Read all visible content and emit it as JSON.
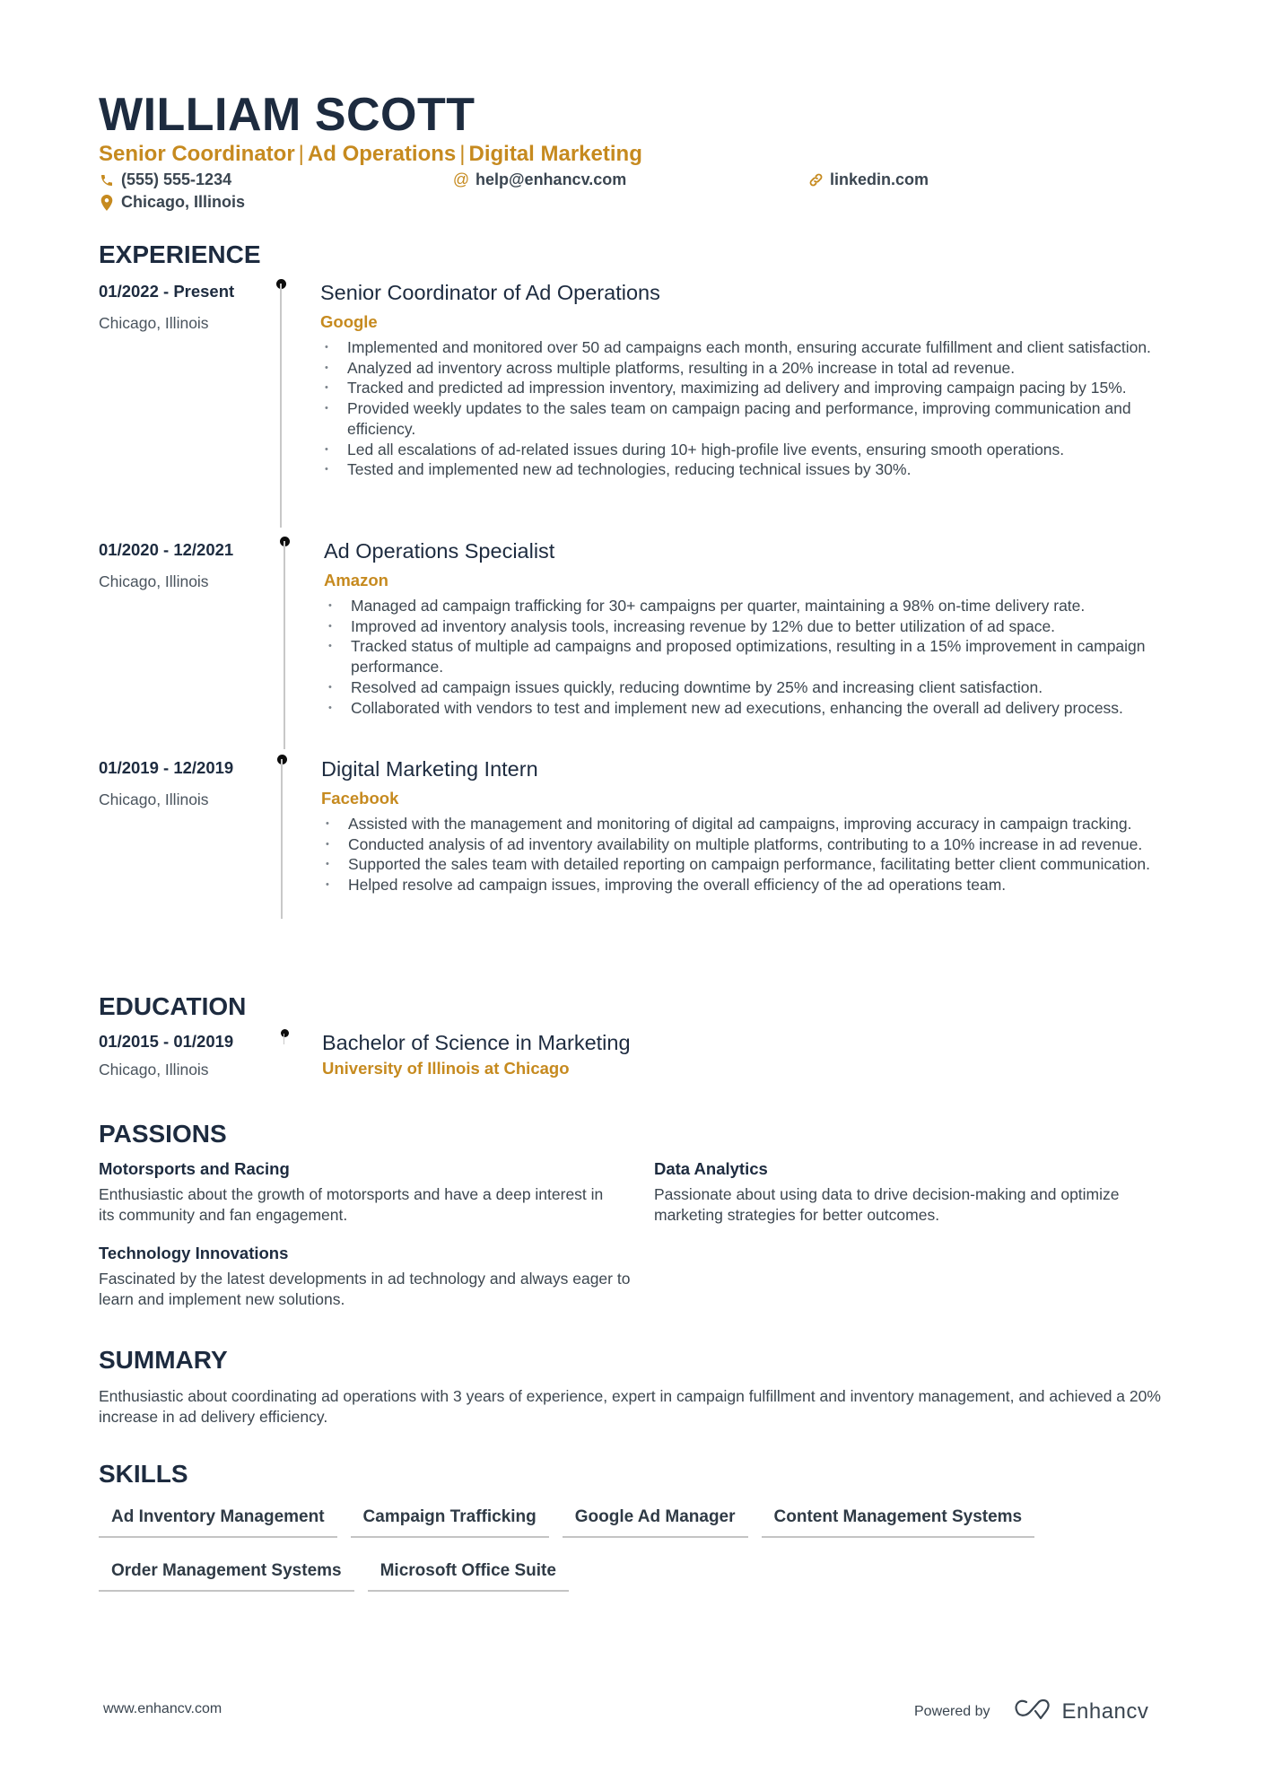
{
  "header": {
    "name": "WILLIAM SCOTT",
    "headline_parts": [
      "Senior Coordinator",
      "Ad Operations",
      "Digital Marketing"
    ],
    "headline_separator": "|",
    "contacts": {
      "phone": {
        "icon": "phone-icon",
        "value": "(555) 555-1234"
      },
      "email": {
        "icon": "at-icon",
        "value": "help@enhancv.com"
      },
      "linkedin": {
        "icon": "link-icon",
        "value": "linkedin.com"
      },
      "location": {
        "icon": "map-pin-icon",
        "value": "Chicago, Illinois"
      }
    }
  },
  "colors": {
    "accent": "#c68a1f",
    "heading": "#1d2b3f",
    "text": "#3d4750"
  },
  "experience": {
    "title": "EXPERIENCE",
    "items": [
      {
        "dates": "01/2022 - Present",
        "location": "Chicago, Illinois",
        "role": "Senior Coordinator of Ad Operations",
        "company": "Google",
        "bullets": [
          "Implemented and monitored over 50 ad campaigns each month, ensuring accurate fulfillment and client satisfaction.",
          "Analyzed ad inventory across multiple platforms, resulting in a 20% increase in total ad revenue.",
          "Tracked and predicted ad impression inventory, maximizing ad delivery and improving campaign pacing by 15%.",
          "Provided weekly updates to the sales team on campaign pacing and performance, improving communication and efficiency.",
          "Led all escalations of ad-related issues during 10+ high-profile live events, ensuring smooth operations.",
          "Tested and implemented new ad technologies, reducing technical issues by 30%."
        ]
      },
      {
        "dates": "01/2020 - 12/2021",
        "location": "Chicago, Illinois",
        "role": "Ad Operations Specialist",
        "company": "Amazon",
        "bullets": [
          "Managed ad campaign trafficking for 30+ campaigns per quarter, maintaining a 98% on-time delivery rate.",
          "Improved ad inventory analysis tools, increasing revenue by 12% due to better utilization of ad space.",
          "Tracked status of multiple ad campaigns and proposed optimizations, resulting in a 15% improvement in campaign performance.",
          "Resolved ad campaign issues quickly, reducing downtime by 25% and increasing client satisfaction.",
          "Collaborated with vendors to test and implement new ad executions, enhancing the overall ad delivery process."
        ]
      },
      {
        "dates": "01/2019 - 12/2019",
        "location": "Chicago, Illinois",
        "role": "Digital Marketing Intern",
        "company": "Facebook",
        "bullets": [
          "Assisted with the management and monitoring of digital ad campaigns, improving accuracy in campaign tracking.",
          "Conducted analysis of ad inventory availability on multiple platforms, contributing to a 10% increase in ad revenue.",
          "Supported the sales team with detailed reporting on campaign performance, facilitating better client communication.",
          "Helped resolve ad campaign issues, improving the overall efficiency of the ad operations team."
        ]
      }
    ]
  },
  "education": {
    "title": "EDUCATION",
    "items": [
      {
        "dates": "01/2015 - 01/2019",
        "location": "Chicago, Illinois",
        "degree": "Bachelor of Science in Marketing",
        "school": "University of Illinois at Chicago"
      }
    ]
  },
  "passions": {
    "title": "PASSIONS",
    "items": [
      {
        "title": "Motorsports and Racing",
        "description": "Enthusiastic about the growth of motorsports and have a deep interest in its community and fan engagement."
      },
      {
        "title": "Data Analytics",
        "description": "Passionate about using data to drive decision-making and optimize marketing strategies for better outcomes."
      },
      {
        "title": "Technology Innovations",
        "description": "Fascinated by the latest developments in ad technology and always eager to learn and implement new solutions."
      }
    ]
  },
  "summary": {
    "title": "SUMMARY",
    "text": "Enthusiastic about coordinating ad operations with 3 years of experience, expert in campaign fulfillment and inventory management, and achieved a 20% increase in ad delivery efficiency."
  },
  "skills": {
    "title": "SKILLS",
    "items": [
      "Ad Inventory Management",
      "Campaign Trafficking",
      "Google Ad Manager",
      "Content Management Systems",
      "Order Management Systems",
      "Microsoft Office Suite"
    ]
  },
  "footer": {
    "website": "www.enhancv.com",
    "powered_by": "Powered by",
    "brand": "Enhancv",
    "brand_icon": "enhancv-logo-icon"
  }
}
